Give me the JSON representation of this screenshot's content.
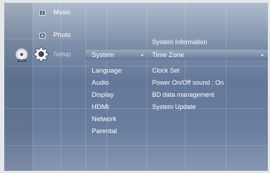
{
  "main_menu": {
    "music": "Music",
    "photo": "Photo",
    "setup": "Setup"
  },
  "disc": {
    "label": "DVD"
  },
  "category_menu": {
    "selected": "System",
    "items": [
      "Language",
      "Audio",
      "Display",
      "HDMI",
      "Network",
      "Parental"
    ]
  },
  "submenu": {
    "header": "System Information",
    "items": [
      {
        "label": "Time Zone",
        "selected": true
      },
      {
        "label": "Clock Set"
      },
      {
        "label": "Power On/Off sound",
        "value": ": On"
      },
      {
        "label": "BD data management"
      },
      {
        "label": "System Update"
      }
    ]
  }
}
